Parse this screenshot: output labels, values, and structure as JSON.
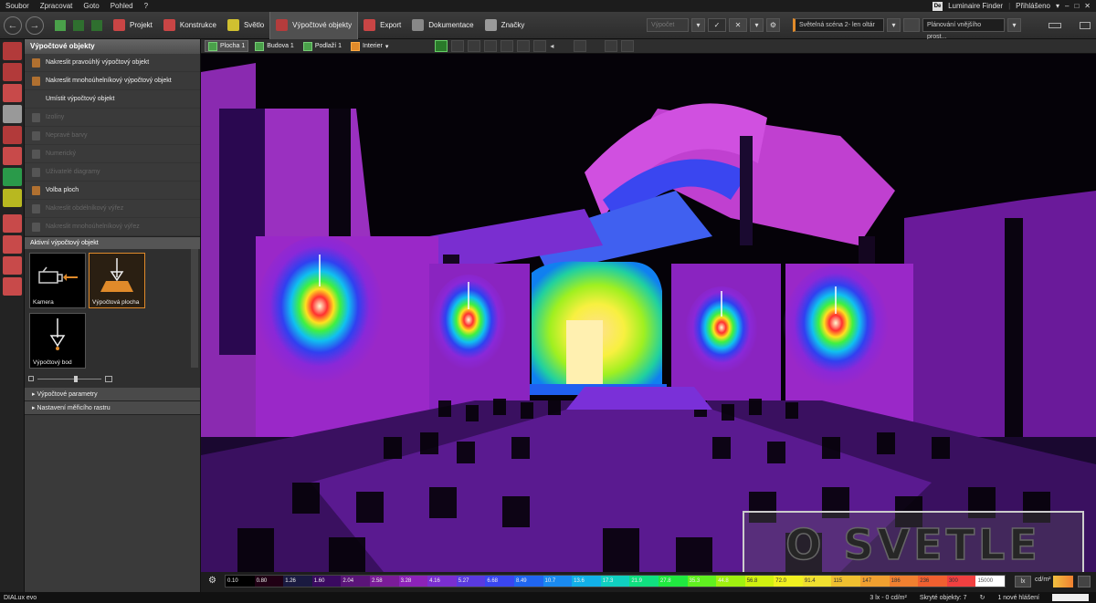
{
  "menu": [
    "Soubor",
    "Zpracovat",
    "Goto",
    "Pohled",
    "?"
  ],
  "top_right": {
    "app_badge": "De",
    "luminaire_finder": "Luminaire Finder",
    "login": "Přihlášeno"
  },
  "toolbar": {
    "tabs": [
      {
        "label": "Projekt",
        "color": "#c94545"
      },
      {
        "label": "Konstrukce",
        "color": "#c94545"
      },
      {
        "label": "Světlo",
        "color": "#d0c030"
      },
      {
        "label": "Výpočtové objekty",
        "color": "#b43c3c"
      },
      {
        "label": "Export",
        "color": "#c94545"
      },
      {
        "label": "Dokumentace",
        "color": "#888888"
      },
      {
        "label": "Značky",
        "color": "#9a9a9a"
      }
    ],
    "compute_label": "Výpočet",
    "scene": "Světelná scéna 2- len oltár",
    "planning": "Plánování vnějšího prost..."
  },
  "left_icons": [
    {
      "name": "draw-surface-icon",
      "color": "#b23a3a"
    },
    {
      "name": "cube-icon",
      "color": "#b23a3a"
    },
    {
      "name": "stairs-icon",
      "color": "#c84a4a"
    },
    {
      "name": "cylinder-icon",
      "color": "#999999"
    },
    {
      "name": "cut-icon",
      "color": "#b23a3a"
    },
    {
      "name": "boolean-icon",
      "color": "#c84a4a"
    },
    {
      "name": "emergency-exit-icon",
      "color": "#2a9a4a"
    },
    {
      "name": "eye-icon",
      "color": "#b8b820"
    },
    {
      "name": "calc-object-icon",
      "color": "#c84a4a"
    },
    {
      "name": "grid-icon",
      "color": "#c84a4a"
    },
    {
      "name": "rect-icon",
      "color": "#c84a4a"
    },
    {
      "name": "network-icon",
      "color": "#c84a4a"
    }
  ],
  "panel": {
    "title": "Výpočtové objekty",
    "items": [
      {
        "label": "Nakreslit pravoúhlý výpočtový objekt",
        "disabled": false
      },
      {
        "label": "Nakreslit mnohoúhelníkový výpočtový objekt",
        "disabled": false
      },
      {
        "label": "Umístit výpočtový objekt",
        "disabled": false
      },
      {
        "label": "Izolíny",
        "disabled": true
      },
      {
        "label": "Nepravé barvy",
        "disabled": true
      },
      {
        "label": "Numerický",
        "disabled": true
      },
      {
        "label": "Uživatelé diagramy",
        "disabled": true
      },
      {
        "label": "Volba ploch",
        "disabled": false
      },
      {
        "label": "Nakreslit obdélníkový výřez",
        "disabled": true
      },
      {
        "label": "Nakreslit mnohoúhelníkový výřez",
        "disabled": true
      }
    ],
    "active_section": "Aktivní výpočtový objekt",
    "thumbs": [
      {
        "label": "Kamera"
      },
      {
        "label": "Výpočtová plocha"
      },
      {
        "label": "Výpočtový bod"
      }
    ],
    "collapsed": [
      "Výpočtové parametry",
      "Nastavení měřicího rastru"
    ]
  },
  "viewbar": {
    "tabs": [
      "Plocha 1",
      "Budova 1",
      "Podlaží 1",
      "Interier"
    ]
  },
  "scale": {
    "values": [
      "0.10",
      "0.80",
      "1.26",
      "1.60",
      "2.04",
      "2.58",
      "3.28",
      "4.16",
      "5.27",
      "6.68",
      "8.49",
      "10.7",
      "13.6",
      "17.3",
      "21.9",
      "27.8",
      "35.3",
      "44.8",
      "56.8",
      "72.0",
      "91.4",
      "115",
      "147",
      "186",
      "236",
      "300",
      "15000"
    ],
    "colors": [
      "#000000",
      "#200014",
      "#1a1a40",
      "#3a0a60",
      "#5a1478",
      "#7a1c98",
      "#8c22b8",
      "#7a2ed0",
      "#5a3ae0",
      "#3a46f0",
      "#2066f0",
      "#1a8af0",
      "#12b0e8",
      "#10d0c0",
      "#10e080",
      "#20e840",
      "#60f020",
      "#a0f010",
      "#d0f010",
      "#f0f020",
      "#f0e030",
      "#f0c030",
      "#f0a030",
      "#f08030",
      "#f06030",
      "#f04040",
      "#ffffff"
    ],
    "unit_lx": "lx",
    "unit_cd": "cd/m²"
  },
  "status": {
    "app": "DIALux evo",
    "readout": "3 lx - 0 cd/m²",
    "hidden": "Skryté objekty: 7",
    "reports": "1 nové hlášení"
  },
  "watermark": "O SVETLE"
}
